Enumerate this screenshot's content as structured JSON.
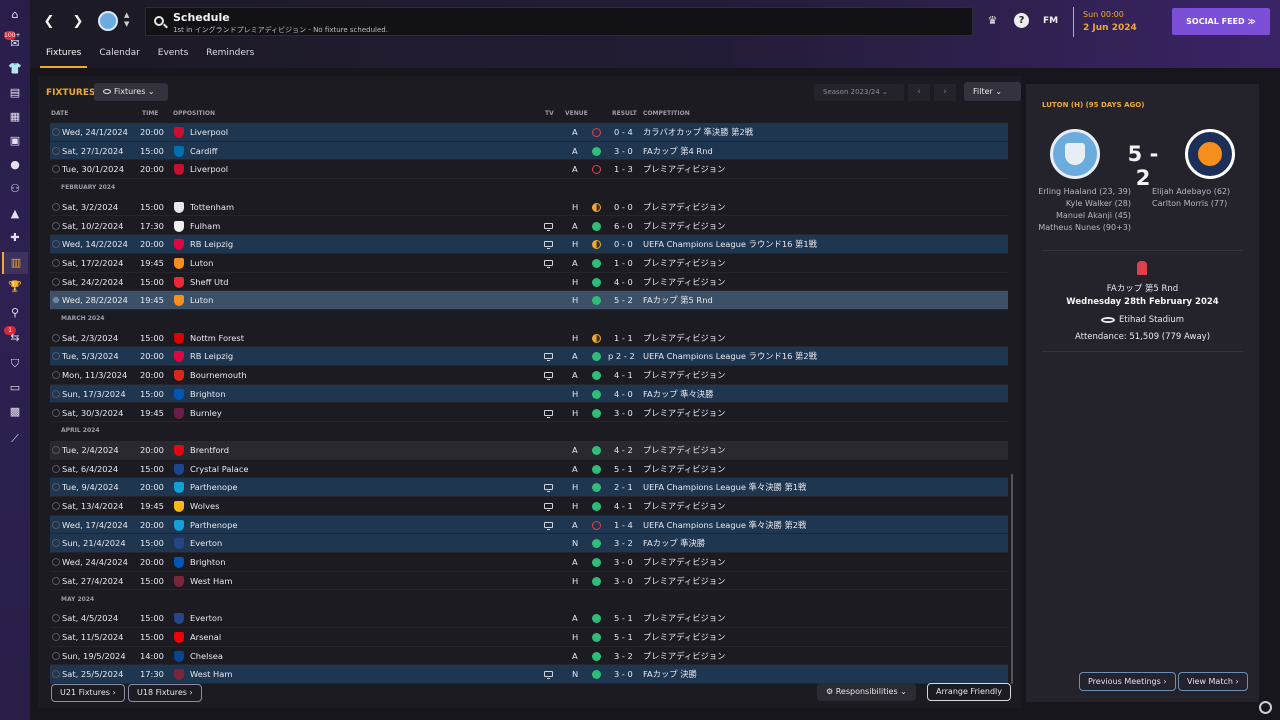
{
  "topbar": {
    "title": "Schedule",
    "subtitle": "1st in イングランドプレミアディビジョン - No fixture scheduled.",
    "logo": "FM",
    "time": "Sun 00:00",
    "date": "2 Jun 2024",
    "social_button": "SOCIAL FEED",
    "rail_badges": [
      "100+",
      "1"
    ],
    "accent_color": "#f0a830",
    "social_color": "#7b4fd8"
  },
  "tabs": [
    "Fixtures",
    "Calendar",
    "Events",
    "Reminders"
  ],
  "fixtures": {
    "heading": "FIXTURES",
    "view_dropdown": "Fixtures",
    "season": "Season 2023/24",
    "filter": "Filter",
    "columns": {
      "date": "DATE",
      "time": "TIME",
      "opposition": "OPPOSITION",
      "tv": "TV",
      "venue": "VENUE",
      "result": "RESULT",
      "competition": "COMPETITION"
    },
    "months": [
      "FEBRUARY 2024",
      "MARCH 2024",
      "APRIL 2024",
      "MAY 2024"
    ],
    "rows": [
      {
        "date": "Wed, 24/1/2024",
        "time": "20:00",
        "opp": "Liverpool",
        "venue": "A",
        "outcome": "loss",
        "result": "0 - 4",
        "comp": "カラバオカップ 準決勝 第2戦"
      },
      {
        "date": "Sat, 27/1/2024",
        "time": "15:00",
        "opp": "Cardiff",
        "venue": "A",
        "outcome": "win",
        "result": "3 - 0",
        "comp": "FAカップ 第4 Rnd"
      },
      {
        "date": "Tue, 30/1/2024",
        "time": "20:00",
        "opp": "Liverpool",
        "venue": "A",
        "outcome": "loss",
        "result": "1 - 3",
        "comp": "プレミアディビジョン"
      },
      {
        "date": "Sat, 3/2/2024",
        "time": "15:00",
        "opp": "Tottenham",
        "venue": "H",
        "outcome": "draw",
        "result": "0 - 0",
        "comp": "プレミアディビジョン"
      },
      {
        "date": "Sat, 10/2/2024",
        "time": "17:30",
        "opp": "Fulham",
        "venue": "A",
        "outcome": "win",
        "result": "6 - 0",
        "comp": "プレミアディビジョン"
      },
      {
        "date": "Wed, 14/2/2024",
        "time": "20:00",
        "opp": "RB Leipzig",
        "venue": "H",
        "outcome": "draw",
        "result": "0 - 0",
        "comp": "UEFA Champions League ラウンド16 第1戦"
      },
      {
        "date": "Sat, 17/2/2024",
        "time": "19:45",
        "opp": "Luton",
        "venue": "A",
        "outcome": "win",
        "result": "1 - 0",
        "comp": "プレミアディビジョン"
      },
      {
        "date": "Sat, 24/2/2024",
        "time": "15:00",
        "opp": "Sheff Utd",
        "venue": "H",
        "outcome": "win",
        "result": "4 - 0",
        "comp": "プレミアディビジョン"
      },
      {
        "date": "Wed, 28/2/2024",
        "time": "19:45",
        "opp": "Luton",
        "venue": "H",
        "outcome": "win",
        "result": "5 - 2",
        "comp": "FAカップ 第5 Rnd"
      },
      {
        "date": "Sat, 2/3/2024",
        "time": "15:00",
        "opp": "Nottm Forest",
        "venue": "H",
        "outcome": "draw",
        "result": "1 - 1",
        "comp": "プレミアディビジョン"
      },
      {
        "date": "Tue, 5/3/2024",
        "time": "20:00",
        "opp": "RB Leipzig",
        "venue": "A",
        "outcome": "win",
        "result": "p 2 - 2",
        "comp": "UEFA Champions League ラウンド16 第2戦"
      },
      {
        "date": "Mon, 11/3/2024",
        "time": "20:00",
        "opp": "Bournemouth",
        "venue": "A",
        "outcome": "win",
        "result": "4 - 1",
        "comp": "プレミアディビジョン"
      },
      {
        "date": "Sun, 17/3/2024",
        "time": "15:00",
        "opp": "Brighton",
        "venue": "H",
        "outcome": "win",
        "result": "4 - 0",
        "comp": "FAカップ 準々決勝"
      },
      {
        "date": "Sat, 30/3/2024",
        "time": "19:45",
        "opp": "Burnley",
        "venue": "H",
        "outcome": "win",
        "result": "3 - 0",
        "comp": "プレミアディビジョン"
      },
      {
        "date": "Tue, 2/4/2024",
        "time": "20:00",
        "opp": "Brentford",
        "venue": "A",
        "outcome": "win",
        "result": "4 - 2",
        "comp": "プレミアディビジョン"
      },
      {
        "date": "Sat, 6/4/2024",
        "time": "15:00",
        "opp": "Crystal Palace",
        "venue": "A",
        "outcome": "win",
        "result": "5 - 1",
        "comp": "プレミアディビジョン"
      },
      {
        "date": "Tue, 9/4/2024",
        "time": "20:00",
        "opp": "Parthenope",
        "venue": "H",
        "outcome": "win",
        "result": "2 - 1",
        "comp": "UEFA Champions League 準々決勝 第1戦"
      },
      {
        "date": "Sat, 13/4/2024",
        "time": "19:45",
        "opp": "Wolves",
        "venue": "H",
        "outcome": "win",
        "result": "4 - 1",
        "comp": "プレミアディビジョン"
      },
      {
        "date": "Wed, 17/4/2024",
        "time": "20:00",
        "opp": "Parthenope",
        "venue": "A",
        "outcome": "loss",
        "result": "1 - 4",
        "comp": "UEFA Champions League 準々決勝 第2戦"
      },
      {
        "date": "Sun, 21/4/2024",
        "time": "15:00",
        "opp": "Everton",
        "venue": "N",
        "outcome": "win",
        "result": "3 - 2",
        "comp": "FAカップ 準決勝"
      },
      {
        "date": "Wed, 24/4/2024",
        "time": "20:00",
        "opp": "Brighton",
        "venue": "A",
        "outcome": "win",
        "result": "3 - 0",
        "comp": "プレミアディビジョン"
      },
      {
        "date": "Sat, 27/4/2024",
        "time": "15:00",
        "opp": "West Ham",
        "venue": "H",
        "outcome": "win",
        "result": "3 - 0",
        "comp": "プレミアディビジョン"
      },
      {
        "date": "Sat, 4/5/2024",
        "time": "15:00",
        "opp": "Everton",
        "venue": "A",
        "outcome": "win",
        "result": "5 - 1",
        "comp": "プレミアディビジョン"
      },
      {
        "date": "Sat, 11/5/2024",
        "time": "15:00",
        "opp": "Arsenal",
        "venue": "H",
        "outcome": "win",
        "result": "5 - 1",
        "comp": "プレミアディビジョン"
      },
      {
        "date": "Sun, 19/5/2024",
        "time": "14:00",
        "opp": "Chelsea",
        "venue": "A",
        "outcome": "win",
        "result": "3 - 2",
        "comp": "プレミアディビジョン"
      },
      {
        "date": "Sat, 25/5/2024",
        "time": "17:30",
        "opp": "West Ham",
        "venue": "N",
        "outcome": "win",
        "result": "3 - 0",
        "comp": "FAカップ 決勝"
      }
    ]
  },
  "bottom": {
    "u21": "U21 Fixtures",
    "u18": "U18 Fixtures",
    "responsibilities": "Responsibilities",
    "arrange": "Arrange Friendly"
  },
  "match": {
    "title": "LUTON (H) (95 DAYS AGO)",
    "score": "5 - 2",
    "home_scorers": [
      "Erling Haaland (23, 39)",
      "Kyle Walker (28)",
      "Manuel Akanji (45)",
      "Matheus Nunes (90+3)"
    ],
    "away_scorers": [
      "Elijah Adebayo (62)",
      "Carlton Morris (77)"
    ],
    "competition": "FAカップ 第5 Rnd",
    "date": "Wednesday 28th February 2024",
    "stadium": "Etihad Stadium",
    "attendance": "Attendance: 51,509 (779 Away)",
    "previous": "Previous Meetings",
    "view": "View Match"
  }
}
